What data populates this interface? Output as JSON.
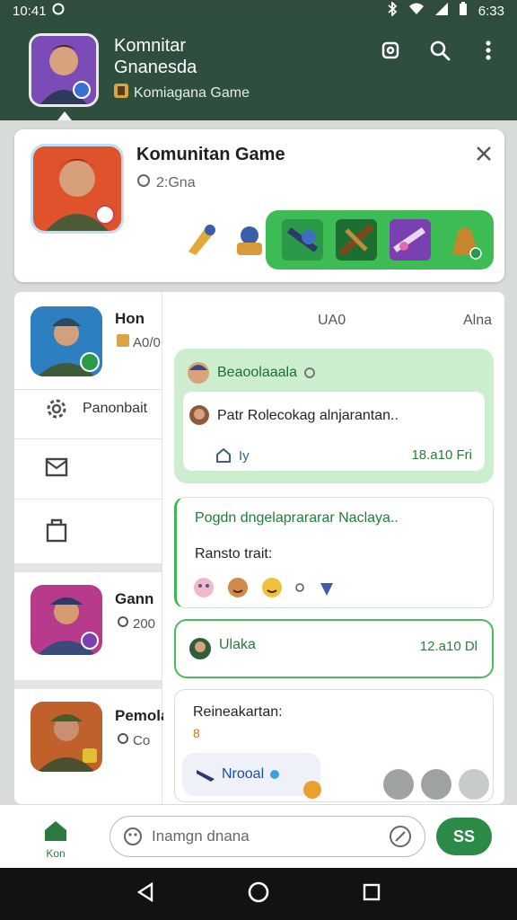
{
  "status": {
    "time": "10:41",
    "right_time": "6:33"
  },
  "appbar": {
    "title_line1": "Komnitar",
    "title_line2": "Gnanesda",
    "subtitle": "Komiagana Game"
  },
  "game_card": {
    "title": "Komunitan Game",
    "meta": "2:Gna"
  },
  "sidebar": {
    "items": [
      {
        "name": "Hon",
        "meta": "A0/0"
      },
      {
        "name": "Gann",
        "meta": "200"
      },
      {
        "name": "Pemola",
        "meta": "Co"
      }
    ],
    "menu_label": "Panonbait"
  },
  "chat": {
    "header_left": "UA0",
    "header_right": "Alna",
    "message1": {
      "sender": "Beaoolaaala",
      "quote": "Patr Rolecokag alnjarantan..",
      "footer": "Iy",
      "time": "18.a10 Fri"
    },
    "message2": {
      "line1": "Pogdn dngelaprararar Naclaya..",
      "line2": "Ransto trait:"
    },
    "message3": {
      "sender": "Ulaka",
      "time": "12.a10 Dl"
    },
    "message4": {
      "text": "Reineakartan:",
      "small": "8",
      "chip_label": "Nrooal"
    }
  },
  "input": {
    "placeholder": "Inamgn dnana",
    "send_label": "SS"
  },
  "bottom_nav": {
    "home_label": "Kon"
  },
  "colors": {
    "primary": "#2e4e3e",
    "accent": "#3dbb55",
    "send": "#2b8a45"
  }
}
